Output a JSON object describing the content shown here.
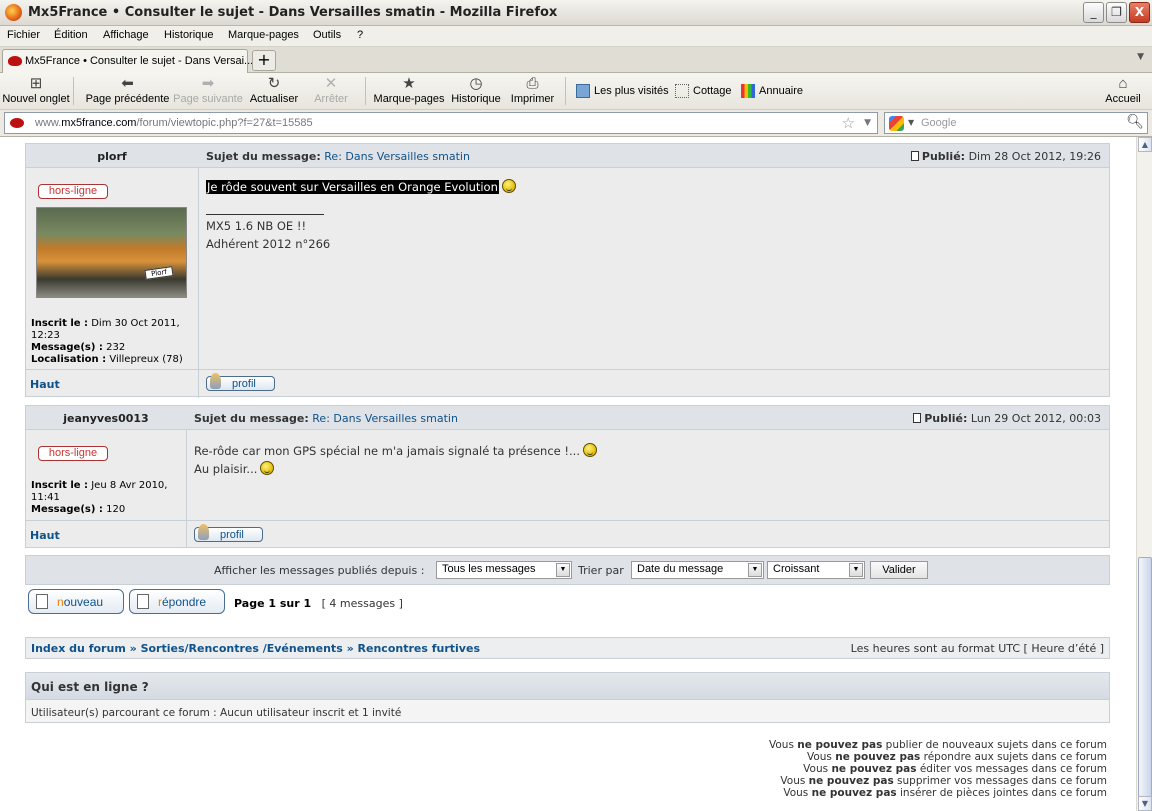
{
  "window": {
    "title": "Mx5France • Consulter le sujet - Dans Versailles smatin - Mozilla Firefox",
    "minimize": "_",
    "restore": "❐",
    "close": "X"
  },
  "menu": [
    "Fichier",
    "Édition",
    "Affichage",
    "Historique",
    "Marque-pages",
    "Outils",
    "?"
  ],
  "tab": {
    "label": "Mx5France • Consulter le sujet - Dans Versai...",
    "new_tab": "+"
  },
  "toolbar": {
    "new_tab": "Nouvel onglet",
    "back": "Page précédente",
    "forward": "Page suivante",
    "reload": "Actualiser",
    "stop": "Arrêter",
    "bookmarks": "Marque-pages",
    "history": "Historique",
    "print": "Imprimer",
    "most_visited": "Les plus visités",
    "cottage": "Cottage",
    "annuaire": "Annuaire",
    "home": "Accueil"
  },
  "address": {
    "prefix": "www.",
    "domain": "mx5france.com",
    "path": "/forum/viewtopic.php?f=27&t=15585"
  },
  "search": {
    "placeholder": "Google"
  },
  "posts": [
    {
      "author": "plorf",
      "subject_label": "Sujet du message:",
      "subject": "Re: Dans Versailles smatin",
      "published_label": "Publié:",
      "published": "Dim 28 Oct 2012, 19:26",
      "status": "hors-ligne",
      "avatar_plate": "Plorf",
      "registered_label": "Inscrit le :",
      "registered": "Dim 30 Oct 2011, 12:23",
      "messages_label": "Message(s) :",
      "messages": "232",
      "location_label": "Localisation :",
      "location": "Villepreux (78)",
      "body_line1": "Je rôde souvent sur Versailles en Orange Evolution",
      "signature_line1": "MX5 1.6 NB OE !!",
      "signature_line2": "Adhérent 2012 n°266",
      "top_link": "Haut",
      "profile_button": "profil"
    },
    {
      "author": "jeanyves0013",
      "subject_label": "Sujet du message:",
      "subject": "Re: Dans Versailles smatin",
      "published_label": "Publié:",
      "published": "Lun 29 Oct 2012, 00:03",
      "status": "hors-ligne",
      "registered_label": "Inscrit le :",
      "registered": "Jeu 8 Avr 2010, 11:41",
      "messages_label": "Message(s) :",
      "messages": "120",
      "body_line1": "Re-rôde car mon GPS spécial ne m'a jamais signalé ta présence !...",
      "body_line2": "Au plaisir...",
      "top_link": "Haut",
      "profile_button": "profil"
    }
  ],
  "sort_bar": {
    "display_label": "Afficher les messages publiés depuis :",
    "display_value": "Tous les messages",
    "sort_label": "Trier par",
    "sort_value": "Date du message",
    "order_value": "Croissant",
    "submit": "Valider"
  },
  "actions": {
    "new_topic_pre": "n",
    "new_topic_rest": "ouveau",
    "reply_pre": "r",
    "reply_rest": "épondre",
    "page_info": "Page 1 sur 1",
    "message_count": "[ 4 messages ]"
  },
  "breadcrumbs": {
    "index": "Index du forum",
    "sep": "»",
    "category": "Sorties/Rencontres /Evénements",
    "forum": "Rencontres furtives",
    "timezone": "Les heures sont au format UTC [ Heure d’été ]"
  },
  "online": {
    "title": "Qui est en ligne ?",
    "text": "Utilisateur(s) parcourant ce forum : Aucun utilisateur inscrit et 1 invité"
  },
  "permissions": [
    {
      "pre": "Vous ",
      "bold": "ne pouvez pas",
      "post": " publier de nouveaux sujets dans ce forum"
    },
    {
      "pre": "Vous ",
      "bold": "ne pouvez pas",
      "post": " répondre aux sujets dans ce forum"
    },
    {
      "pre": "Vous ",
      "bold": "ne pouvez pas",
      "post": " éditer vos messages dans ce forum"
    },
    {
      "pre": "Vous ",
      "bold": "ne pouvez pas",
      "post": " supprimer vos messages dans ce forum"
    },
    {
      "pre": "Vous ",
      "bold": "ne pouvez pas",
      "post": " insérer de pièces jointes dans ce forum"
    }
  ],
  "colors": {
    "link": "#105289",
    "offline": "#cc3333",
    "accent_orange": "#f08000"
  }
}
